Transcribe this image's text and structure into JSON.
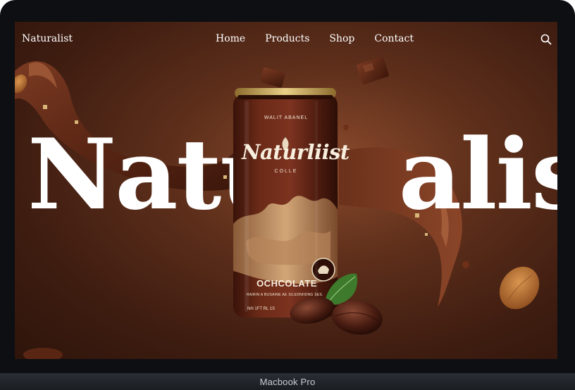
{
  "device": {
    "label": "Macbook Pro"
  },
  "nav": {
    "brand": "Naturalist",
    "items": [
      "Home",
      "Products",
      "Shop",
      "Contact"
    ],
    "search_icon": "search-icon"
  },
  "hero": {
    "title_left": "Natu",
    "title_right": "alist"
  },
  "product": {
    "tagline": "WALIT ABANEL",
    "brand": "Naturliist",
    "subtitle": "COLLE",
    "flavor": "OCHCOLATE",
    "fine_print": "HAIRIN A BUSAINE AE SILEDNIIDNG SEIL",
    "fine_print_2": "NH 1FT RL 1S"
  },
  "colors": {
    "background": "#4a2415",
    "text": "#ffffff",
    "can": "#5a2414",
    "can_rim": "#c9a35a"
  }
}
